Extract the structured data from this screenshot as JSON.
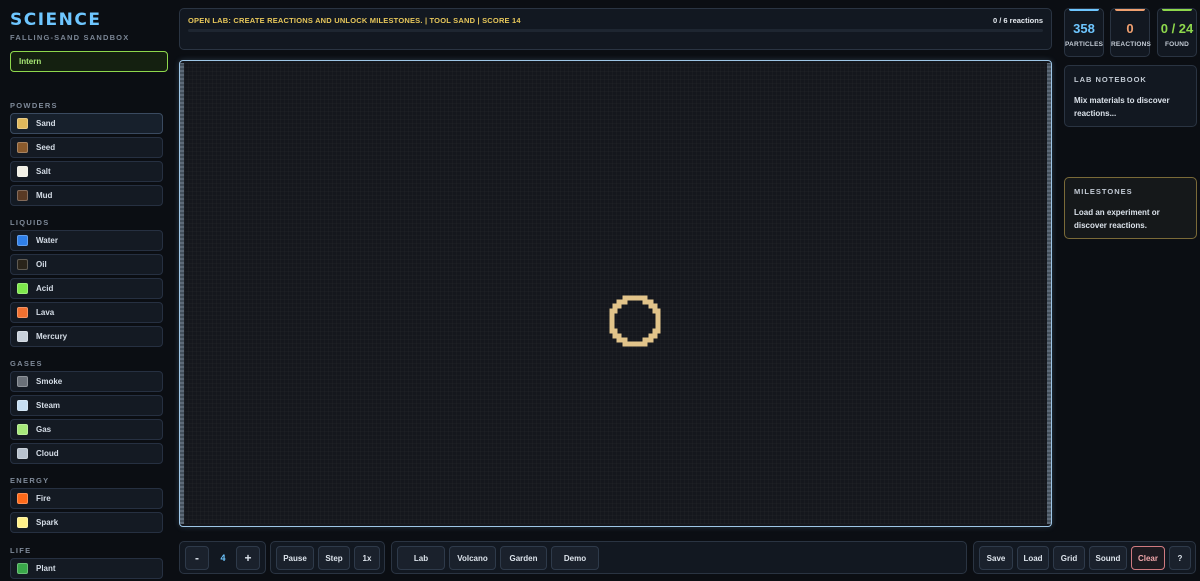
{
  "brand": {
    "title": "SCIENCE",
    "subtitle": "FALLING-SAND SANDBOX"
  },
  "rank": "Intern",
  "categories": {
    "powders": "POWDERS",
    "liquids": "LIQUIDS",
    "gases": "GASES",
    "energy": "ENERGY",
    "life": "LIFE"
  },
  "materials": {
    "sand": {
      "label": "Sand",
      "color": "#e0b85c"
    },
    "seed": {
      "label": "Seed",
      "color": "#8a5a2c"
    },
    "salt": {
      "label": "Salt",
      "color": "#f2f0e6"
    },
    "mud": {
      "label": "Mud",
      "color": "#5a3a24"
    },
    "water": {
      "label": "Water",
      "color": "#2f7fe8"
    },
    "oil": {
      "label": "Oil",
      "color": "#2a241a"
    },
    "acid": {
      "label": "Acid",
      "color": "#7ee84c"
    },
    "lava": {
      "label": "Lava",
      "color": "#f07030"
    },
    "mercury": {
      "label": "Mercury",
      "color": "#c8d0da"
    },
    "smoke": {
      "label": "Smoke",
      "color": "#6a7078"
    },
    "steam": {
      "label": "Steam",
      "color": "#c6def2"
    },
    "gas": {
      "label": "Gas",
      "color": "#a6e87a"
    },
    "cloud": {
      "label": "Cloud",
      "color": "#b8c2ce"
    },
    "fire": {
      "label": "Fire",
      "color": "#ff6a1a"
    },
    "spark": {
      "label": "Spark",
      "color": "#fff08a"
    },
    "plant": {
      "label": "Plant",
      "color": "#3aa84a"
    }
  },
  "status": {
    "message": "OPEN LAB: CREATE REACTIONS AND UNLOCK MILESTONES. | TOOL SAND | SCORE 14",
    "reactions_count": "0 / 6 reactions",
    "progress_fraction": 0
  },
  "stats": {
    "particles": {
      "value": "358",
      "label": "PARTICLES",
      "color": "#6ec6ff"
    },
    "reactions": {
      "value": "0",
      "label": "REACTIONS",
      "color": "#f0a070"
    },
    "found": {
      "value": "0 / 24",
      "label": "FOUND",
      "color": "#8ed84c"
    }
  },
  "notebook": {
    "title": "LAB NOTEBOOK",
    "body": "Mix materials to discover reactions..."
  },
  "milestones": {
    "title": "MILESTONES",
    "body": "Load an experiment or discover reactions."
  },
  "controls": {
    "brush_minus": "-",
    "brush_size": "4",
    "brush_plus": "+",
    "pause": "Pause",
    "step": "Step",
    "speed": "1x",
    "lab": "Lab",
    "volcano": "Volcano",
    "garden": "Garden",
    "demo": "Demo",
    "save": "Save",
    "load": "Load",
    "grid": "Grid",
    "sound": "Sound",
    "clear": "Clear",
    "help": "?"
  },
  "colors": {
    "accent": "#6ec6ff",
    "status_text": "#e6c65a",
    "canvas_border": "#9ec6e6",
    "cursor_ring": "#e2c48a"
  }
}
